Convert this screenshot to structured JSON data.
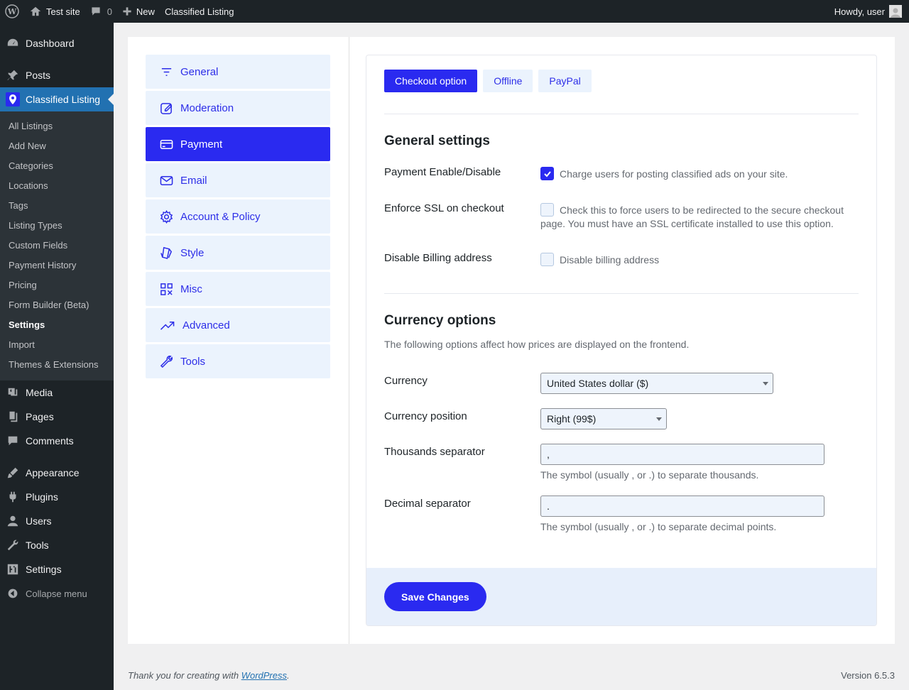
{
  "adminbar": {
    "site_name": "Test site",
    "comments_count": "0",
    "new_label": "New",
    "plugin_label": "Classified Listing",
    "howdy": "Howdy, user"
  },
  "sidebar": {
    "dashboard": "Dashboard",
    "posts": "Posts",
    "classified": "Classified Listing",
    "submenu": [
      "All Listings",
      "Add New",
      "Categories",
      "Locations",
      "Tags",
      "Listing Types",
      "Custom Fields",
      "Payment History",
      "Pricing",
      "Form Builder (Beta)",
      "Settings",
      "Import",
      "Themes & Extensions"
    ],
    "active_submenu": "Settings",
    "media": "Media",
    "pages": "Pages",
    "comments": "Comments",
    "appearance": "Appearance",
    "plugins": "Plugins",
    "users": "Users",
    "tools": "Tools",
    "settings": "Settings",
    "collapse": "Collapse menu"
  },
  "settings_tabs": [
    "General",
    "Moderation",
    "Payment",
    "Email",
    "Account & Policy",
    "Style",
    "Misc",
    "Advanced",
    "Tools"
  ],
  "active_settings_tab": "Payment",
  "payment_tabs": [
    "Checkout option",
    "Offline",
    "PayPal"
  ],
  "active_payment_tab": "Checkout option",
  "general": {
    "title": "General settings",
    "payment_enable_label": "Payment Enable/Disable",
    "payment_enable_text": "Charge users for posting classified ads on your site.",
    "payment_enable_checked": true,
    "ssl_label": "Enforce SSL on checkout",
    "ssl_text": "Check this to force users to be redirected to the secure checkout page. You must have an SSL certificate installed to use this option.",
    "ssl_checked": false,
    "billing_label": "Disable Billing address",
    "billing_text": "Disable billing address",
    "billing_checked": false
  },
  "currency": {
    "title": "Currency options",
    "desc": "The following options affect how prices are displayed on the frontend.",
    "currency_label": "Currency",
    "currency_value": "United States dollar ($)",
    "position_label": "Currency position",
    "position_value": "Right (99$)",
    "thousands_label": "Thousands separator",
    "thousands_value": ",",
    "thousands_help": "The symbol (usually , or .) to separate thousands.",
    "decimal_label": "Decimal separator",
    "decimal_value": ".",
    "decimal_help": "The symbol (usually , or .) to separate decimal points."
  },
  "save_label": "Save Changes",
  "footer": {
    "thanks_prefix": "Thank you for creating with ",
    "thanks_link": "WordPress",
    "thanks_suffix": ".",
    "version": "Version 6.5.3"
  },
  "colors": {
    "accent": "#2a2af0",
    "wp_admin_bg": "#1d2327",
    "wp_current": "#2271b1"
  }
}
